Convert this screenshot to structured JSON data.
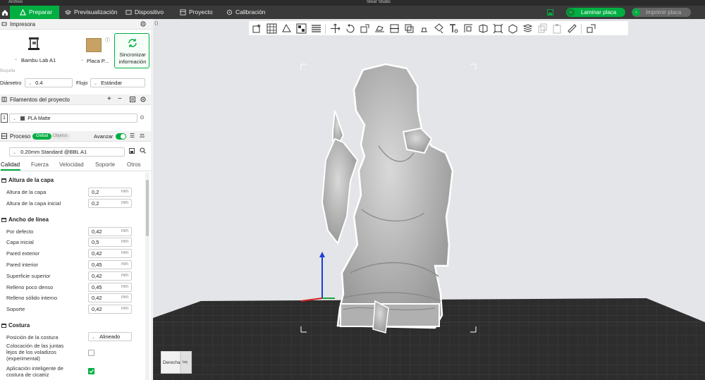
{
  "window": {
    "title": "Slicer Studio",
    "menu_label": "Archivo"
  },
  "nav": {
    "tabs": [
      {
        "label": "Preparar",
        "active": true
      },
      {
        "label": "Previsualización"
      },
      {
        "label": "Dispositivo"
      },
      {
        "label": "Proyecto"
      },
      {
        "label": "Calibración"
      }
    ],
    "slice_button": "Laminar placa",
    "print_button": "Imprimir placa"
  },
  "printer": {
    "section_label": "Impresora",
    "printer_name": "Bambu Lab A1",
    "plate_name": "Placa P...",
    "sync_label_1": "Sincronizar",
    "sync_label_2": "información",
    "nozzle_group_label": "Boquilla",
    "diameter_label": "Diámetro",
    "diameter_value": "0.4",
    "flow_label": "Flujo",
    "flow_value": "Estándar"
  },
  "filaments": {
    "section_label": "Filamentos del proyecto",
    "items": [
      {
        "index": "1",
        "name": "PLA Matte"
      }
    ]
  },
  "process": {
    "section_label": "Proceso",
    "toggle_global": "Global",
    "toggle_objects": "Objetos",
    "advanced_label": "Avanzar",
    "profile": "0.20mm Standard @BBL A1",
    "tabs": [
      "Calidad",
      "Fuerza",
      "Velocidad",
      "Soporte",
      "Otros"
    ],
    "groups": [
      {
        "title": "Altura de la capa",
        "rows": [
          {
            "label": "Altura de la capa",
            "value": "0,2",
            "unit": "mm"
          },
          {
            "label": "Altura de la capa inicial",
            "value": "0,2",
            "unit": "mm"
          }
        ]
      },
      {
        "title": "Ancho de línea",
        "rows": [
          {
            "label": "Por defecto",
            "value": "0,42",
            "unit": "mm"
          },
          {
            "label": "Capa inicial",
            "value": "0,5",
            "unit": "mm"
          },
          {
            "label": "Pared exterior",
            "value": "0,42",
            "unit": "mm"
          },
          {
            "label": "Pared interior",
            "value": "0,45",
            "unit": "mm"
          },
          {
            "label": "Superficie superior",
            "value": "0,42",
            "unit": "mm"
          },
          {
            "label": "Relleno poco denso",
            "value": "0,45",
            "unit": "mm"
          },
          {
            "label": "Relleno sólido interno",
            "value": "0,42",
            "unit": "mm"
          },
          {
            "label": "Soporte",
            "value": "0,42",
            "unit": "mm"
          }
        ]
      },
      {
        "title": "Costura",
        "seam_position_label": "Posición de la costura",
        "seam_position_value": "Alineado",
        "overhang_label_1": "Colocación de las juntas",
        "overhang_label_2": "lejos de los voladizos",
        "overhang_label_3": "(experimental)",
        "overhang_checked": false,
        "scarf_label_1": "Aplicación inteligente de",
        "scarf_label_2": "costura de cicatriz",
        "scarf_checked": true
      }
    ]
  },
  "viewport": {
    "view_cube_label": "Derecha",
    "view_cube_side": "Izq"
  },
  "colors": {
    "accent": "#00ae42",
    "nav_bg": "#3a3a3a",
    "bed": "#2d2d2d",
    "model": "#b8b8b8"
  }
}
